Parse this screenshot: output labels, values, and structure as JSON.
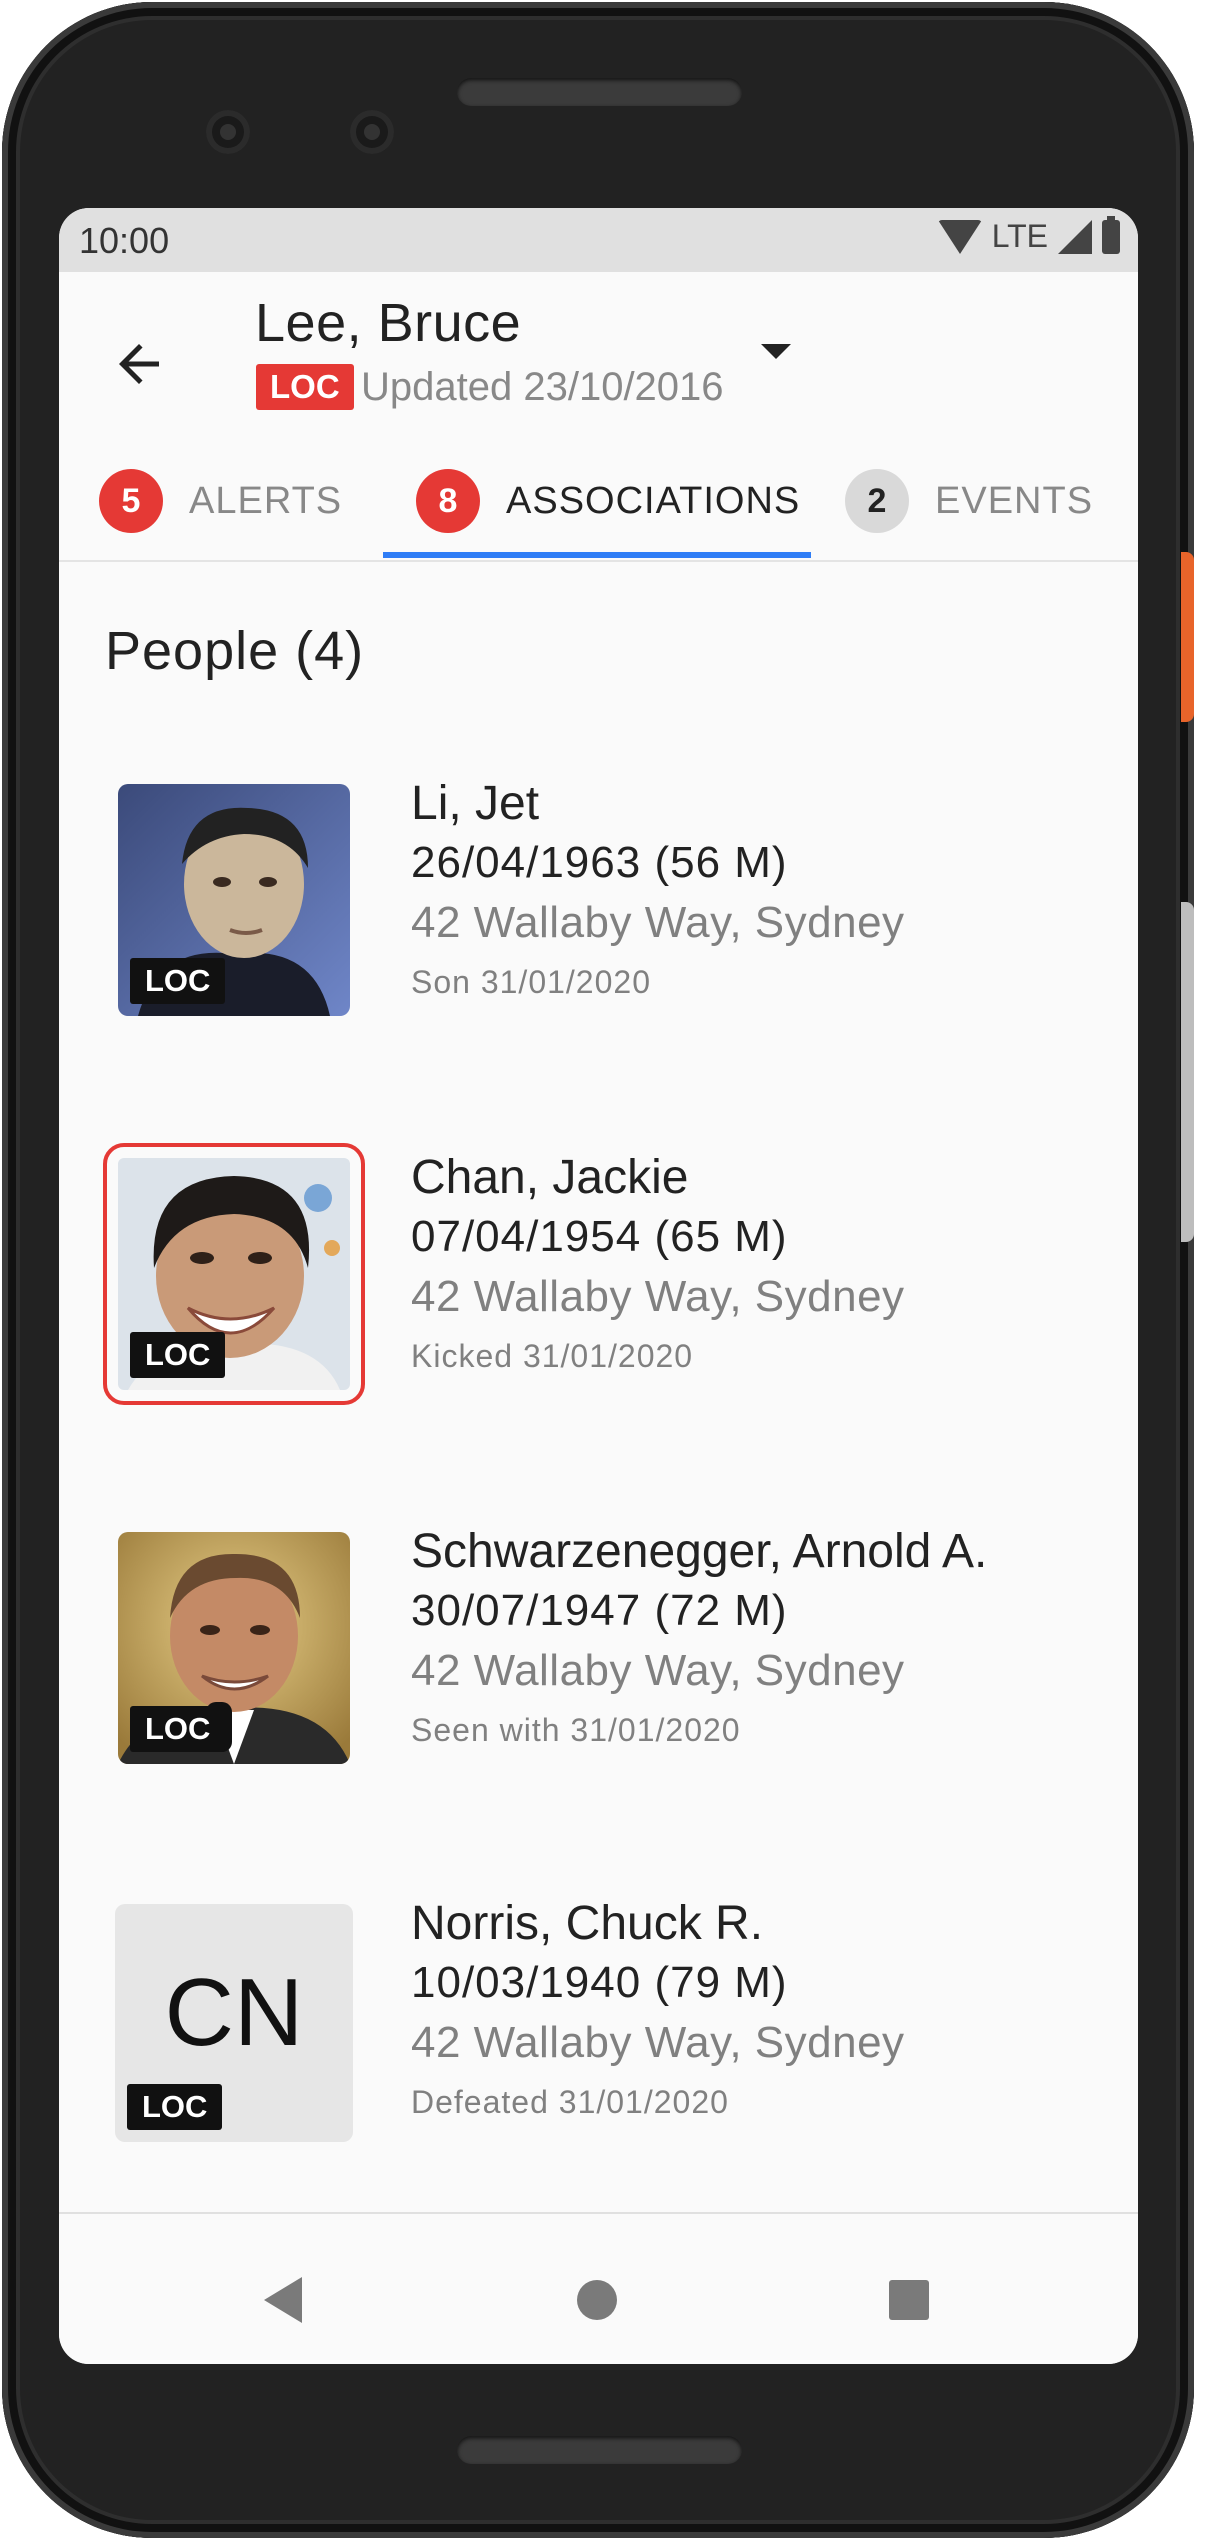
{
  "status_bar": {
    "time": "10:00",
    "network": "LTE"
  },
  "header": {
    "title": "Lee, Bruce",
    "badge": "LOC",
    "updated": "Updated 23/10/2016",
    "back_icon": "arrow-left-icon",
    "dropdown_icon": "caret-down-icon"
  },
  "tabs": [
    {
      "count": "5",
      "label": "ALERTS",
      "active": false
    },
    {
      "count": "8",
      "label": "ASSOCIATIONS",
      "active": true
    },
    {
      "count": "2",
      "label": "EVENTS",
      "active": false
    }
  ],
  "section": {
    "title": "People (4)"
  },
  "people": [
    {
      "name": "Li, Jet",
      "dob": "26/04/1963 (56 M)",
      "address": "42 Wallaby Way, Sydney",
      "relation": "Son 31/01/2020",
      "badge": "LOC",
      "selected": false
    },
    {
      "name": "Chan, Jackie",
      "dob": "07/04/1954 (65 M)",
      "address": "42 Wallaby Way, Sydney",
      "relation": "Kicked 31/01/2020",
      "badge": "LOC",
      "selected": true
    },
    {
      "name": "Schwarzenegger, Arnold A.",
      "dob": "30/07/1947 (72 M)",
      "address": "42 Wallaby Way, Sydney",
      "relation": "Seen with 31/01/2020",
      "badge": "LOC",
      "selected": false
    },
    {
      "name": "Norris, Chuck R.",
      "dob": "10/03/1940 (79 M)",
      "address": "42 Wallaby Way, Sydney",
      "relation": "Defeated 31/01/2020",
      "badge": "LOC",
      "initials": "CN",
      "selected": false
    }
  ],
  "nav": {
    "back_icon": "triangle-back-icon",
    "home_icon": "circle-home-icon",
    "recents_icon": "square-recents-icon"
  },
  "colors": {
    "accent": "#2f7df6",
    "badge_red": "#e53935",
    "selected_outline": "#e53935"
  }
}
